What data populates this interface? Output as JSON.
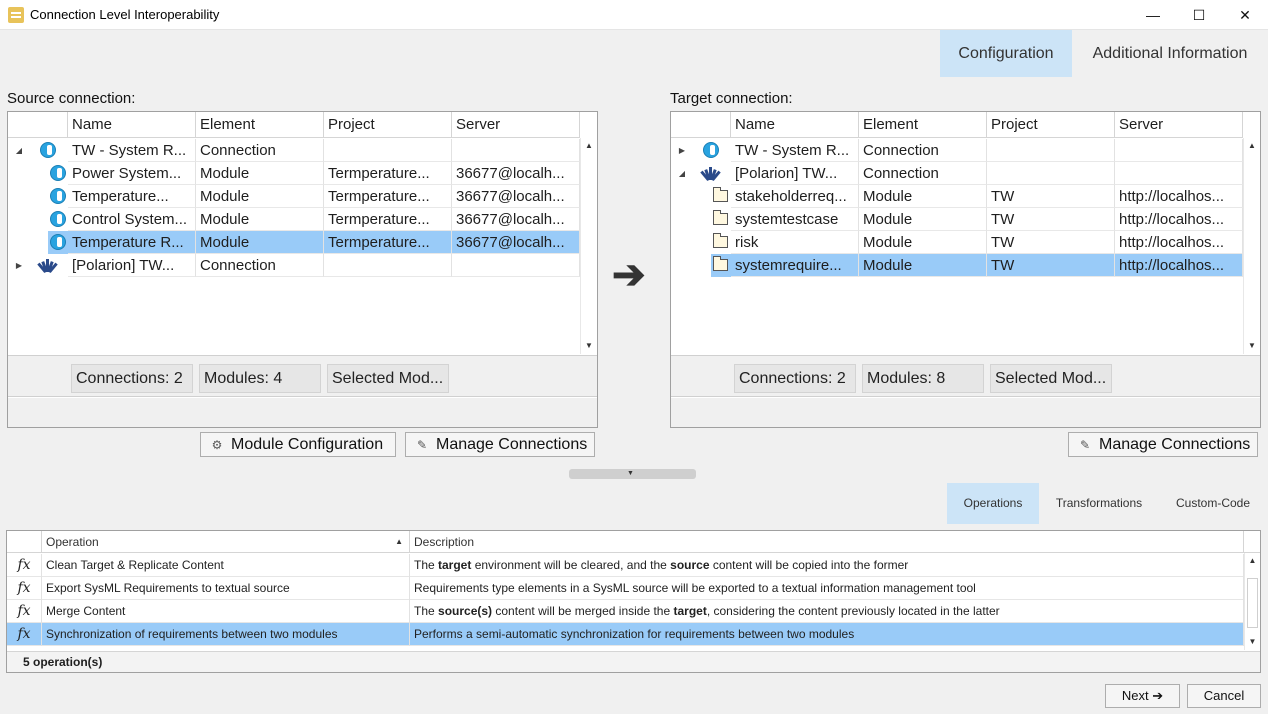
{
  "window": {
    "title": "Connection Level Interoperability",
    "minimize": "—",
    "maximize": "☐",
    "close": "✕"
  },
  "top_tabs": [
    "Configuration",
    "Additional Information"
  ],
  "source": {
    "label": "Source connection:",
    "columns": [
      "Name",
      "Element",
      "Project",
      "Server"
    ],
    "rows": [
      {
        "name": "TW - System R...",
        "element": "Connection",
        "project": "",
        "server": "",
        "icon": "tw-icon",
        "expander": "◢"
      },
      {
        "name": "Power System...",
        "element": "Module",
        "project": "Termperature...",
        "server": "36677@localh...",
        "icon": "tw-icon"
      },
      {
        "name": "Temperature...",
        "element": "Module",
        "project": "Termperature...",
        "server": "36677@localh...",
        "icon": "tw-icon"
      },
      {
        "name": "Control System...",
        "element": "Module",
        "project": "Termperature...",
        "server": "36677@localh...",
        "icon": "tw-icon"
      },
      {
        "name": "Temperature R...",
        "element": "Module",
        "project": "Termperature...",
        "server": "36677@localh...",
        "icon": "tw-icon",
        "selected": true
      },
      {
        "name": "[Polarion] TW...",
        "element": "Connection",
        "project": "",
        "server": "",
        "icon": "polarion-icon",
        "expander": "▶"
      }
    ],
    "stats": [
      "Connections: 2",
      "Modules: 4",
      "Selected Mod..."
    ],
    "buttons": {
      "module_config": "Module Configuration",
      "manage": "Manage Connections"
    }
  },
  "target": {
    "label": "Target connection:",
    "columns": [
      "Name",
      "Element",
      "Project",
      "Server"
    ],
    "rows": [
      {
        "name": "TW - System R...",
        "element": "Connection",
        "project": "",
        "server": "",
        "icon": "tw-icon",
        "expander": "▶"
      },
      {
        "name": "[Polarion] TW...",
        "element": "Connection",
        "project": "",
        "server": "",
        "icon": "polarion-icon",
        "expander": "◢"
      },
      {
        "name": "stakeholderreq...",
        "element": "Module",
        "project": "TW",
        "server": "http://localhos...",
        "icon": "folder-icon"
      },
      {
        "name": "systemtestcase",
        "element": "Module",
        "project": "TW",
        "server": "http://localhos...",
        "icon": "folder-icon"
      },
      {
        "name": "risk",
        "element": "Module",
        "project": "TW",
        "server": "http://localhos...",
        "icon": "folder-icon"
      },
      {
        "name": "systemrequire...",
        "element": "Module",
        "project": "TW",
        "server": "http://localhos...",
        "icon": "folder-icon",
        "selected": true
      }
    ],
    "stats": [
      "Connections: 2",
      "Modules: 8",
      "Selected Mod..."
    ],
    "buttons": {
      "manage": "Manage Connections"
    }
  },
  "arrow": "➔",
  "ops_tabs": [
    "Operations",
    "Transformations",
    "Custom-Code"
  ],
  "operations": {
    "columns": [
      "Operation",
      "Description"
    ],
    "sort_indicator": "▲",
    "rows": [
      {
        "icon": "fx",
        "name": "Clean Target & Replicate Content",
        "desc": [
          {
            "t": "The "
          },
          {
            "t": "target",
            "b": true
          },
          {
            "t": " environment will be cleared, and the "
          },
          {
            "t": "source",
            "b": true
          },
          {
            "t": " content will be copied into the former"
          }
        ]
      },
      {
        "icon": "fx",
        "name": "Export SysML Requirements to textual source",
        "desc": [
          {
            "t": "Requirements type elements in a SysML source will be exported to a textual information management tool"
          }
        ]
      },
      {
        "icon": "fx",
        "name": "Merge Content",
        "desc": [
          {
            "t": "The "
          },
          {
            "t": "source(s)",
            "b": true
          },
          {
            "t": " content will be merged inside the "
          },
          {
            "t": "target",
            "b": true
          },
          {
            "t": ", considering the content previously located in the latter"
          }
        ]
      },
      {
        "icon": "fx",
        "name": "Synchronization of requirements between two modules",
        "selected": true,
        "desc": [
          {
            "t": "Performs a semi-automatic synchronization for requirements between two modules"
          }
        ]
      }
    ],
    "count": "5 operation(s)"
  },
  "footer": {
    "next": "Next ➔",
    "cancel": "Cancel"
  },
  "colors": {
    "selection": "#99cbf8",
    "active_tab": "#cce4f7",
    "tw_blue": "#29a3e0"
  }
}
